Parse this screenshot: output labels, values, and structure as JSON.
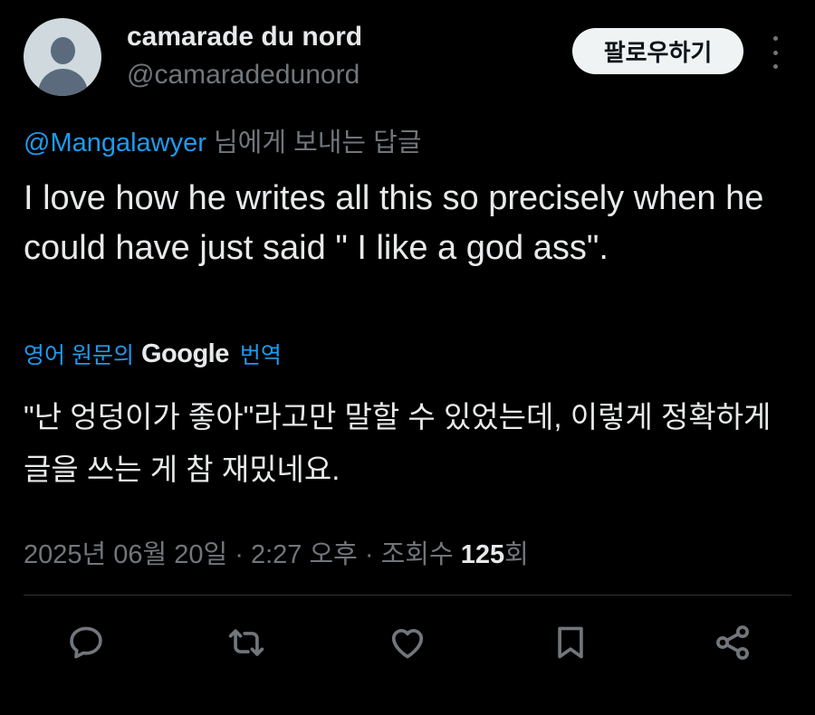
{
  "user": {
    "display_name": "camarade du nord",
    "handle": "@camaradedunord"
  },
  "follow_button_label": "팔로우하기",
  "reply_context": {
    "mention": "@Mangalawyer",
    "suffix": " 님에게 보내는 답글"
  },
  "tweet_text": "I love how he writes all this so precisely when he could have just said \" I like a god ass\".",
  "translation": {
    "prefix": "영어 원문의",
    "brand": "Google",
    "suffix": "번역",
    "text": "\"난 엉덩이가 좋아\"라고만 말할 수 있었는데, 이렇게 정확하게 글을 쓰는 게 참 재밌네요."
  },
  "meta": {
    "date": "2025년 06월 20일",
    "separator": " · ",
    "time": "2:27 오후",
    "views_label": "조회수 ",
    "views_count": "125",
    "views_suffix": "회"
  },
  "actions": [
    {
      "icon": "reply-icon"
    },
    {
      "icon": "retweet-icon"
    },
    {
      "icon": "like-icon"
    },
    {
      "icon": "bookmark-icon"
    },
    {
      "icon": "share-icon"
    }
  ],
  "colors": {
    "background": "#000000",
    "text": "#e7e9ea",
    "muted": "#71767b",
    "accent": "#1d9bf0",
    "divider": "#2f3336"
  }
}
